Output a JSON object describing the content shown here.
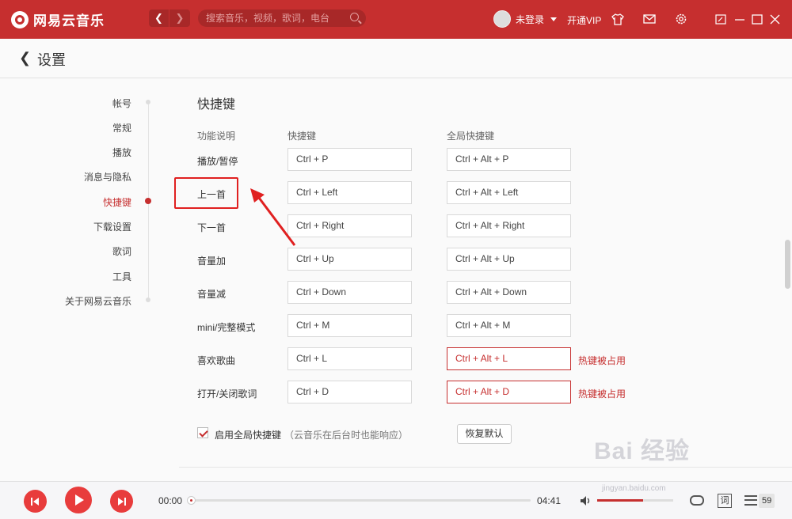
{
  "app": {
    "name": "网易云音乐",
    "search_placeholder": "搜索音乐，视频，歌词，电台",
    "user": "未登录",
    "vip": "开通VIP",
    "colors": {
      "brand": "#c62f2f",
      "conflict": "#c62f2f"
    }
  },
  "header": {
    "title": "设置"
  },
  "sidebar": {
    "items": [
      {
        "label": "帐号",
        "active": false
      },
      {
        "label": "常规",
        "active": false
      },
      {
        "label": "播放",
        "active": false
      },
      {
        "label": "消息与隐私",
        "active": false
      },
      {
        "label": "快捷键",
        "active": true
      },
      {
        "label": "下载设置",
        "active": false
      },
      {
        "label": "歌词",
        "active": false
      },
      {
        "label": "工具",
        "active": false
      },
      {
        "label": "关于网易云音乐",
        "active": false
      }
    ]
  },
  "hotkeys": {
    "title": "快捷键",
    "col_function": "功能说明",
    "col_hotkey": "快捷键",
    "col_global": "全局快捷键",
    "rows": [
      {
        "label": "播放/暂停",
        "hotkey": "Ctrl + P",
        "global": "Ctrl + Alt + P",
        "conflict": ""
      },
      {
        "label": "上一首",
        "hotkey": "Ctrl + Left",
        "global": "Ctrl + Alt + Left",
        "conflict": ""
      },
      {
        "label": "下一首",
        "hotkey": "Ctrl + Right",
        "global": "Ctrl + Alt + Right",
        "conflict": ""
      },
      {
        "label": "音量加",
        "hotkey": "Ctrl + Up",
        "global": "Ctrl + Alt + Up",
        "conflict": ""
      },
      {
        "label": "音量减",
        "hotkey": "Ctrl + Down",
        "global": "Ctrl + Alt + Down",
        "conflict": ""
      },
      {
        "label": "mini/完整模式",
        "hotkey": "Ctrl + M",
        "global": "Ctrl + Alt + M",
        "conflict": ""
      },
      {
        "label": "喜欢歌曲",
        "hotkey": "Ctrl + L",
        "global": "Ctrl + Alt + L",
        "conflict": "热键被占用"
      },
      {
        "label": "打开/关闭歌词",
        "hotkey": "Ctrl + D",
        "global": "Ctrl + Alt + D",
        "conflict": "热键被占用"
      }
    ],
    "enable_global_label": "启用全局快捷键",
    "enable_global_note": "（云音乐在后台时也能响应）",
    "enable_global_checked": true,
    "restore_default": "恢复默认"
  },
  "player": {
    "current_time": "00:00",
    "total_time": "04:41",
    "progress": 0,
    "volume_fraction": 0.6,
    "lyric_label": "词",
    "playlist_count": "59",
    "icons": [
      "prev-icon",
      "play-icon",
      "next-icon",
      "volume-icon",
      "loop-icon",
      "playlist-icon"
    ]
  },
  "watermark": {
    "text": "Bai 经验",
    "url": "jingyan.baidu.com"
  }
}
